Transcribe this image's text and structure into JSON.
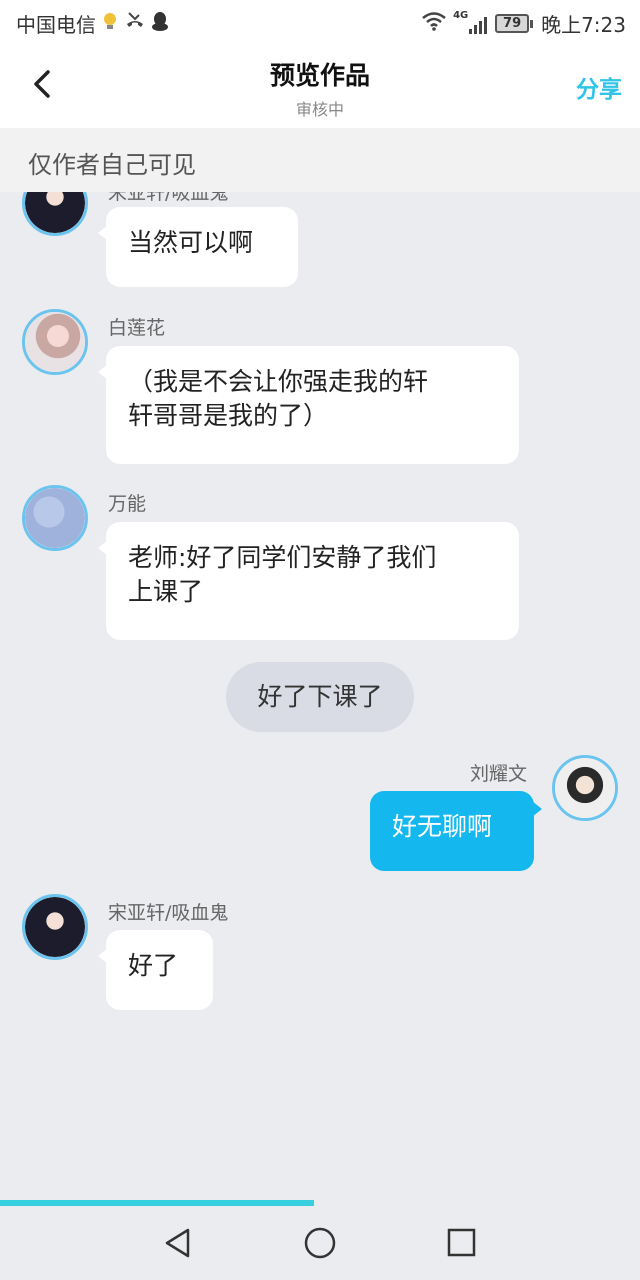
{
  "status_bar": {
    "carrier": "中国电信",
    "network": "4G",
    "battery": "79",
    "time": "晚上7:23"
  },
  "header": {
    "title": "预览作品",
    "subtitle": "审核中",
    "share_label": "分享"
  },
  "notice": "仅作者自己可见",
  "messages": [
    {
      "name": "宋亚轩/吸血鬼",
      "text": "当然可以啊"
    },
    {
      "name": "白莲花",
      "lines": [
        "（我是不会让你强走我的轩",
        "轩哥哥是我的了）"
      ]
    },
    {
      "name": "万能",
      "lines": [
        "老师:好了同学们安静了我们",
        "上课了"
      ]
    },
    {
      "system": "好了下课了"
    },
    {
      "name": "刘耀文",
      "text": "好无聊啊"
    },
    {
      "name": "宋亚轩/吸血鬼",
      "text": "好了"
    }
  ],
  "progress": 0.49,
  "icons": {
    "back": "back-arrow-icon",
    "nav_back": "triangle-back-icon",
    "nav_home": "circle-home-icon",
    "nav_recent": "square-recent-icon"
  },
  "colors": {
    "accent": "#31c4e8",
    "outgoing_bubble": "#15b8ee",
    "background": "#ebecf0"
  }
}
